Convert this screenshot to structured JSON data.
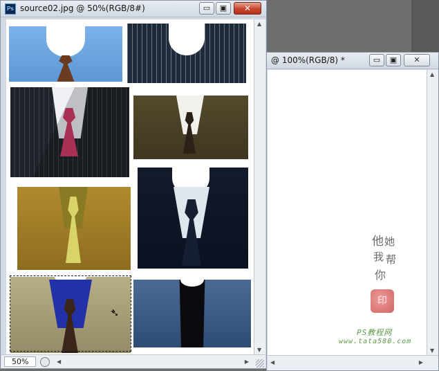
{
  "window_front": {
    "title": "source02.jpg @ 50%(RGB/8#)",
    "app_badge": "Ps",
    "zoom": "50%",
    "minimize_glyph": "▭",
    "maximize_glyph": "▣",
    "close_glyph": "✕"
  },
  "window_back": {
    "title": "@ 100%(RGB/8) *",
    "minimize_glyph": "▭",
    "maximize_glyph": "▣",
    "close_glyph": "✕"
  },
  "watermark": {
    "calligraphy": [
      "他",
      "她",
      "我",
      "帮",
      "你"
    ],
    "seal": "印",
    "site_name": "PS教程网",
    "site_url": "www.tata580.com"
  },
  "colors": {
    "chrome": "#d3dae3",
    "close_button": "#c8442c",
    "workspace": "#6e6e6e"
  },
  "icons": {
    "cursor": "pointer-scissors-icon"
  }
}
